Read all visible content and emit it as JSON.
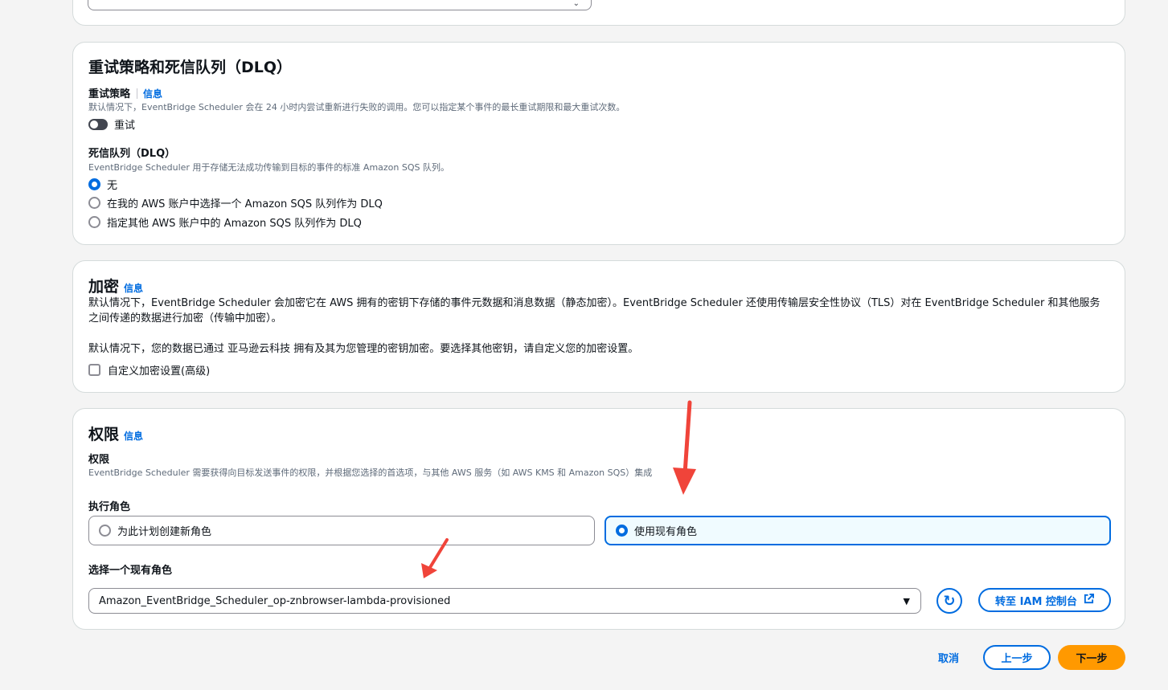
{
  "retry_section": {
    "title": "重试策略和死信队列（DLQ）",
    "retry_policy_label": "重试策略",
    "info_link": "信息",
    "retry_policy_desc": "默认情况下，EventBridge Scheduler 会在 24 小时内尝试重新进行失败的调用。您可以指定某个事件的最长重试期限和最大重试次数。",
    "retry_toggle_label": "重试",
    "dlq_label": "死信队列（DLQ）",
    "dlq_desc": "EventBridge Scheduler 用于存储无法成功传输到目标的事件的标准 Amazon SQS 队列。",
    "dlq_options": [
      {
        "label": "无",
        "checked": true
      },
      {
        "label": "在我的 AWS 账户中选择一个 Amazon SQS 队列作为 DLQ",
        "checked": false
      },
      {
        "label": "指定其他 AWS 账户中的 Amazon SQS 队列作为 DLQ",
        "checked": false
      }
    ]
  },
  "encryption_section": {
    "title": "加密",
    "info_link": "信息",
    "desc": "默认情况下，EventBridge Scheduler 会加密它在 AWS 拥有的密钥下存储的事件元数据和消息数据（静态加密）。EventBridge Scheduler 还使用传输层安全性协议（TLS）对在 EventBridge Scheduler 和其他服务之间传递的数据进行加密（传输中加密）。",
    "default_note": "默认情况下，您的数据已通过 亚马逊云科技 拥有及其为您管理的密钥加密。要选择其他密钥，请自定义您的加密设置。",
    "custom_checkbox_label": "自定义加密设置(高级)"
  },
  "permissions_section": {
    "title": "权限",
    "info_link": "信息",
    "perm_label": "权限",
    "perm_desc": "EventBridge Scheduler 需要获得向目标发送事件的权限，并根据您选择的首选项，与其他 AWS 服务（如 AWS KMS 和 Amazon SQS）集成",
    "exec_role_label": "执行角色",
    "role_options": [
      {
        "label": "为此计划创建新角色",
        "checked": false
      },
      {
        "label": "使用现有角色",
        "checked": true
      }
    ],
    "select_role_label": "选择一个现有角色",
    "selected_role": "Amazon_EventBridge_Scheduler_op-znbrowser-lambda-provisioned",
    "iam_button": "转至 IAM 控制台"
  },
  "footer": {
    "cancel": "取消",
    "previous": "上一步",
    "next": "下一步"
  },
  "colors": {
    "accent": "#006ce0",
    "primary_button": "#ff9900",
    "annotation_arrow": "#f0443a"
  }
}
